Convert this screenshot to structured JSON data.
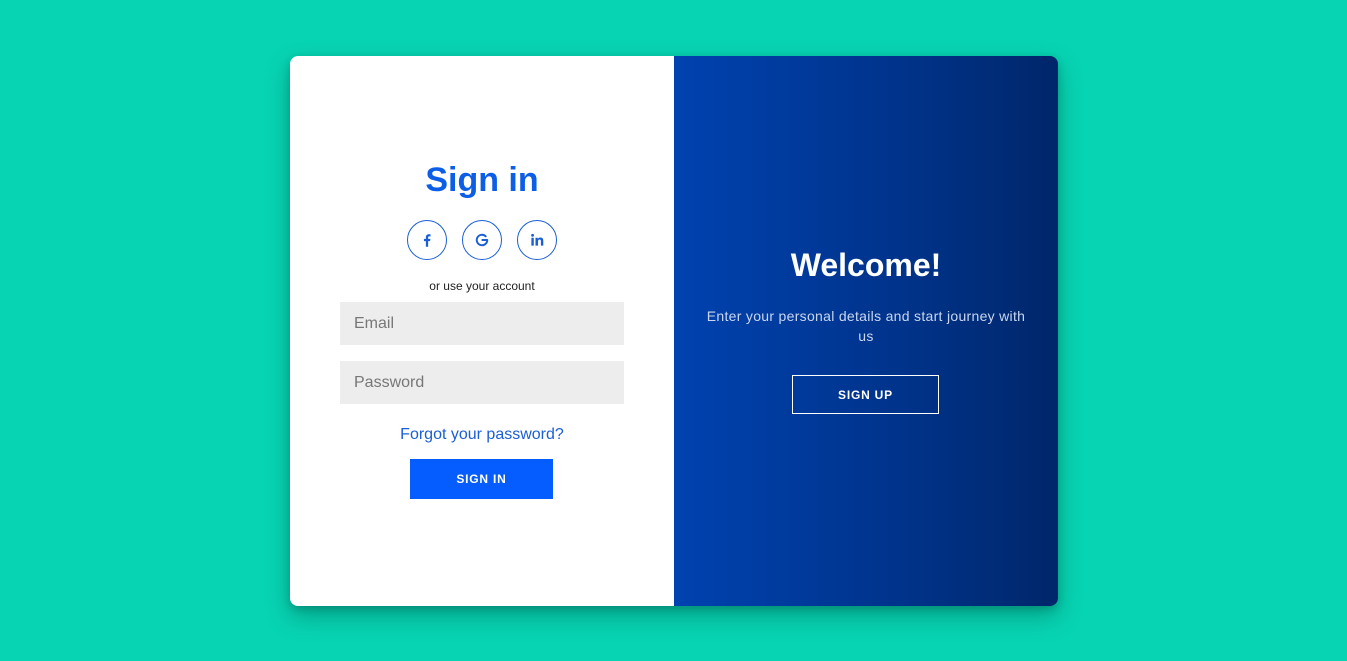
{
  "signin": {
    "title": "Sign in",
    "socials": [
      {
        "icon": "facebook-icon"
      },
      {
        "icon": "google-icon"
      },
      {
        "icon": "linkedin-icon"
      }
    ],
    "alt_text": "or use your account",
    "email_placeholder": "Email",
    "password_placeholder": "Password",
    "forgot_label": "Forgot your password?",
    "button_label": "SIGN IN"
  },
  "welcome": {
    "title": "Welcome!",
    "text": "Enter your personal details and start journey with us",
    "button_label": "SIGN UP"
  },
  "colors": {
    "background": "#07d4b3",
    "accent": "#055cff",
    "title_blue": "#0d5ee6",
    "panel_gradient_start": "#0042b0",
    "panel_gradient_end": "#00266a"
  }
}
